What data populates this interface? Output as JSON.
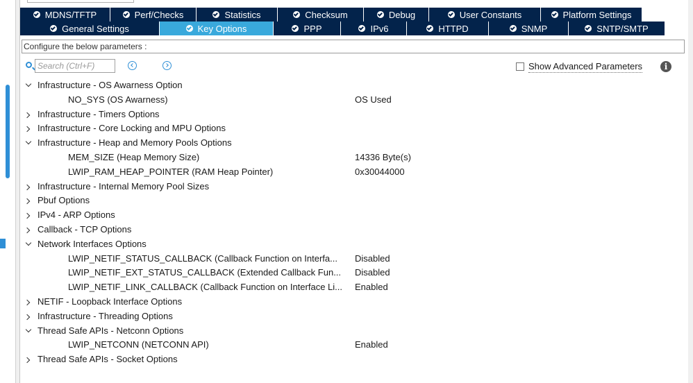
{
  "tabs": {
    "row1": [
      {
        "label": "MDNS/TFTP",
        "w": 130
      },
      {
        "label": "Perf/Checks",
        "w": 124
      },
      {
        "label": "Statistics",
        "w": 117
      },
      {
        "label": "Checksum",
        "w": 124
      },
      {
        "label": "Debug",
        "w": 94
      },
      {
        "label": "User Constants",
        "w": 161
      },
      {
        "label": "Platform Settings",
        "w": 146
      }
    ],
    "row2": [
      {
        "label": "General Settings",
        "w": 201,
        "active": false
      },
      {
        "label": "Key Options",
        "w": 164,
        "active": true
      },
      {
        "label": "PPP",
        "w": 97,
        "active": false
      },
      {
        "label": "IPv6",
        "w": 95,
        "active": false
      },
      {
        "label": "HTTPD",
        "w": 118,
        "active": false
      },
      {
        "label": "SNMP",
        "w": 115,
        "active": false
      },
      {
        "label": "SNTP/SMTP",
        "w": 139,
        "active": false
      }
    ]
  },
  "config_label": "Configure the below parameters :",
  "search": {
    "placeholder": "Search (Ctrl+F)"
  },
  "advanced": {
    "label": "Show Advanced Parameters",
    "checked": false
  },
  "tree": [
    {
      "type": "group",
      "label": "Infrastructure - OS Awarness Option",
      "open": true
    },
    {
      "type": "param",
      "label": "NO_SYS (OS Awarness)",
      "value": "OS Used"
    },
    {
      "type": "group",
      "label": "Infrastructure - Timers Options",
      "open": false
    },
    {
      "type": "group",
      "label": "Infrastructure - Core Locking and MPU Options",
      "open": false
    },
    {
      "type": "group",
      "label": "Infrastructure - Heap and Memory Pools Options",
      "open": true
    },
    {
      "type": "param",
      "label": "MEM_SIZE (Heap Memory Size)",
      "value": "14336 Byte(s)"
    },
    {
      "type": "param",
      "label": "LWIP_RAM_HEAP_POINTER (RAM Heap Pointer)",
      "value": "0x30044000"
    },
    {
      "type": "group",
      "label": "Infrastructure - Internal Memory Pool Sizes",
      "open": false
    },
    {
      "type": "group",
      "label": "Pbuf Options",
      "open": false
    },
    {
      "type": "group",
      "label": "IPv4 - ARP Options",
      "open": false
    },
    {
      "type": "group",
      "label": "Callback - TCP Options",
      "open": false
    },
    {
      "type": "group",
      "label": "Network Interfaces Options",
      "open": true
    },
    {
      "type": "param",
      "label": "LWIP_NETIF_STATUS_CALLBACK (Callback Function on Interfa...",
      "value": "Disabled"
    },
    {
      "type": "param",
      "label": "LWIP_NETIF_EXT_STATUS_CALLBACK (Extended Callback Fun...",
      "value": "Disabled"
    },
    {
      "type": "param",
      "label": "LWIP_NETIF_LINK_CALLBACK (Callback Function on Interface Li...",
      "value": "Enabled"
    },
    {
      "type": "group",
      "label": "NETIF - Loopback Interface Options",
      "open": false
    },
    {
      "type": "group",
      "label": "Infrastructure - Threading Options",
      "open": false
    },
    {
      "type": "group",
      "label": "Thread Safe APIs - Netconn Options",
      "open": true
    },
    {
      "type": "param",
      "label": "LWIP_NETCONN (NETCONN API)",
      "value": "Enabled"
    },
    {
      "type": "group",
      "label": "Thread Safe APIs - Socket Options",
      "open": false
    }
  ]
}
